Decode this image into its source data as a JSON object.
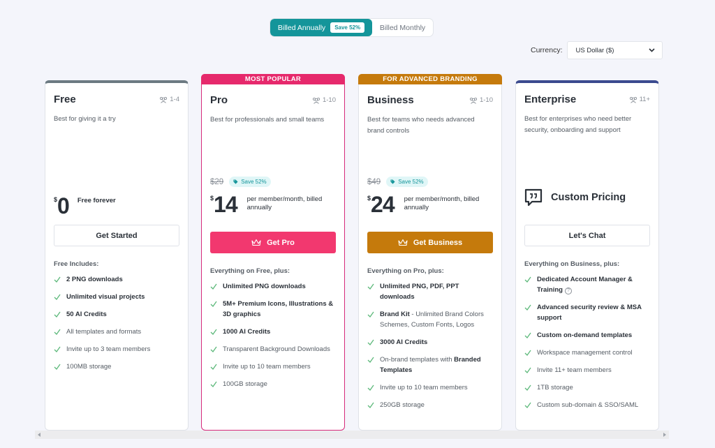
{
  "billing": {
    "annual_label": "Billed Annually",
    "annual_save": "Save 52%",
    "monthly_label": "Billed Monthly",
    "selected": "annual"
  },
  "currency": {
    "label": "Currency:",
    "selected": "US Dollar ($)"
  },
  "colors": {
    "teal": "#14959a",
    "pro_pink": "#e6296c",
    "business_orange": "#c57a0c",
    "enterprise_navy": "#3b4a8f",
    "free_gray": "#6c7a82",
    "check_green": "#5cb87a"
  },
  "plans": {
    "free": {
      "name": "Free",
      "team_size": "1-4",
      "description": "Best for giving it a try",
      "currency_symbol": "$",
      "price": "0",
      "price_note": "Free forever",
      "cta": "Get Started",
      "features_title": "Free Includes:",
      "features": [
        "2 PNG downloads",
        "Unlimited visual projects",
        "50 AI Credits",
        "All templates and formats",
        "Invite up to 3 team members",
        "100MB storage"
      ]
    },
    "pro": {
      "banner": "MOST POPULAR",
      "name": "Pro",
      "team_size": "1-10",
      "description": "Best for professionals and small teams",
      "old_price": "$29",
      "save_tag": "Save 52%",
      "currency_symbol": "$",
      "price": "14",
      "price_note": "per member/month, billed annually",
      "cta": "Get Pro",
      "features_title": "Everything on Free, plus:",
      "features": [
        "Unlimited PNG downloads",
        "5M+ Premium Icons, Illustrations & 3D graphics",
        "1000 AI Credits",
        "Transparent Background Downloads",
        "Invite up to 10 team members",
        "100GB storage"
      ]
    },
    "business": {
      "banner": "FOR ADVANCED BRANDING",
      "name": "Business",
      "team_size": "1-10",
      "description": "Best for teams who needs advanced brand controls",
      "old_price": "$49",
      "save_tag": "Save 52%",
      "currency_symbol": "$",
      "price": "24",
      "price_note": "per member/month, billed annually",
      "cta": "Get Business",
      "features_title": "Everything on Pro, plus:",
      "features": {
        "f0": "Unlimited PNG, PDF, PPT downloads",
        "f1_bold": "Brand Kit",
        "f1_rest": " - Unlimited Brand Colors Schemes, Custom Fonts, Logos",
        "f2": "3000 AI Credits",
        "f3_rest": "On-brand templates with ",
        "f3_bold": "Branded Templates",
        "f4": "Invite up to 10 team members",
        "f5": "250GB storage"
      }
    },
    "enterprise": {
      "name": "Enterprise",
      "team_size": "11+",
      "description": "Best for enterprises who need better security, onboarding and support",
      "custom_pricing": "Custom Pricing",
      "cta": "Let's Chat",
      "features_title": "Everything on Business, plus:",
      "features": [
        "Dedicated Account Manager & Training",
        "Advanced security review & MSA support",
        "Custom on-demand templates",
        "Workspace management control",
        "Invite 11+ team members",
        "1TB storage",
        "Custom sub-domain & SSO/SAML"
      ],
      "help_glyph": "?"
    }
  }
}
